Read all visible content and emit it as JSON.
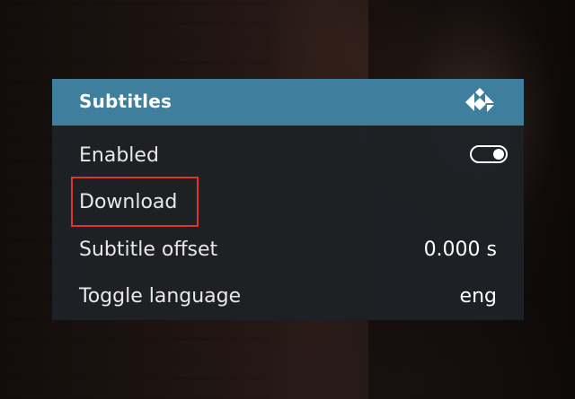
{
  "dialog": {
    "title": "Subtitles",
    "logo_icon": "kodi-logo-icon",
    "header_color": "#3f7e9c"
  },
  "rows": [
    {
      "label": "Enabled",
      "control": "toggle",
      "toggle_on": true
    },
    {
      "label": "Download"
    },
    {
      "label": "Subtitle offset",
      "value": "0.000 s"
    },
    {
      "label": "Toggle language",
      "value": "eng"
    }
  ],
  "highlight": {
    "target": "Download",
    "color": "#e0342a"
  }
}
